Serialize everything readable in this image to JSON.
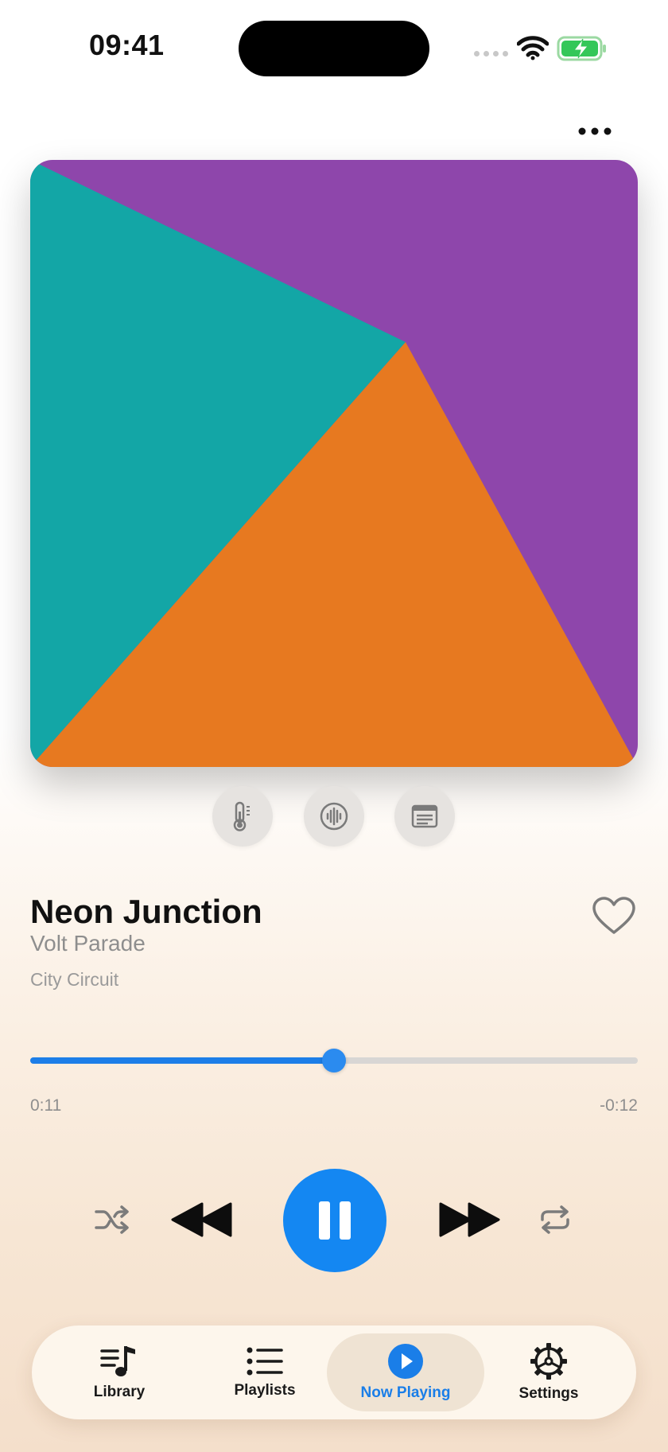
{
  "status_bar": {
    "time": "09:41"
  },
  "header": {
    "more_icon": "ellipsis-icon"
  },
  "artwork": {
    "colors": [
      "#8e46ab",
      "#13a6a6",
      "#e77920"
    ]
  },
  "quick_actions": [
    {
      "icon": "thermometer-icon"
    },
    {
      "icon": "waveform-icon"
    },
    {
      "icon": "lyrics-card-icon"
    }
  ],
  "song": {
    "title": "Neon Junction",
    "artist": "Volt Parade",
    "album": "City Circuit",
    "favorite": false
  },
  "progress": {
    "elapsed": "0:11",
    "remaining": "-0:12",
    "fraction": 0.5
  },
  "controls": {
    "shuffle_icon": "shuffle-icon",
    "previous_icon": "backward-icon",
    "play_state": "playing",
    "next_icon": "forward-icon",
    "repeat_icon": "repeat-icon",
    "accent": "#1487f2"
  },
  "tabs": [
    {
      "label": "Library",
      "icon": "library-icon"
    },
    {
      "label": "Playlists",
      "icon": "list-icon"
    },
    {
      "label": "Now Playing",
      "icon": "play-circle-icon",
      "active": true
    },
    {
      "label": "Settings",
      "icon": "gear-icon"
    }
  ]
}
